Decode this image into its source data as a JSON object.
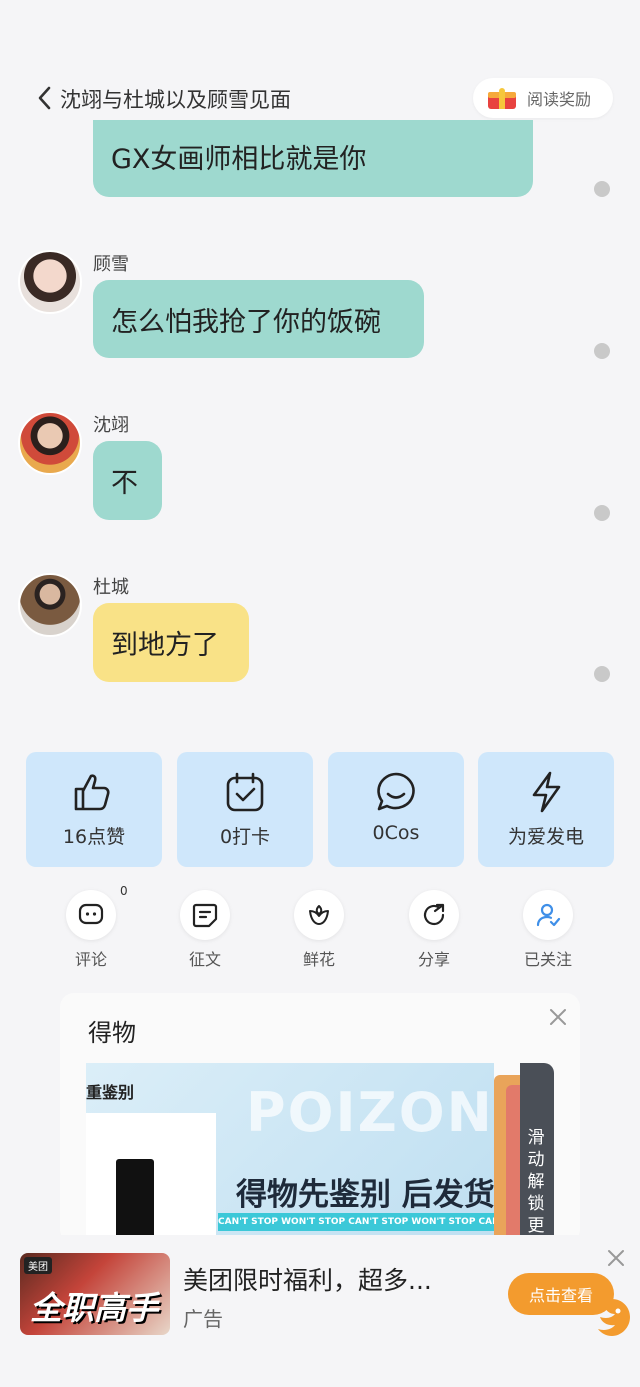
{
  "header": {
    "title": "沈翊与杜城以及顾雪见面",
    "reward_label": "阅读奖励"
  },
  "messages": [
    {
      "sender": "",
      "text": "GX女画师相比就是你",
      "color": "teal"
    },
    {
      "sender": "顾雪",
      "text": "怎么怕我抢了你的饭碗",
      "color": "teal"
    },
    {
      "sender": "沈翊",
      "text": "不",
      "color": "teal"
    },
    {
      "sender": "杜城",
      "text": "到地方了",
      "color": "yellow"
    }
  ],
  "stats": [
    {
      "label": "16点赞",
      "icon": "thumbs-up-icon"
    },
    {
      "label": "0打卡",
      "icon": "calendar-check-icon"
    },
    {
      "label": "0Cos",
      "icon": "chat-smile-icon"
    },
    {
      "label": "为爱发电",
      "icon": "lightning-icon"
    }
  ],
  "actions": [
    {
      "label": "评论",
      "icon": "comment-icon",
      "badge": "0"
    },
    {
      "label": "征文",
      "icon": "essay-icon"
    },
    {
      "label": "鲜花",
      "icon": "flower-icon"
    },
    {
      "label": "分享",
      "icon": "share-icon"
    },
    {
      "label": "已关注",
      "icon": "user-check-icon"
    }
  ],
  "ad_card": {
    "title": "得物",
    "banner_tag": "重鉴别",
    "banner_watermark": "POIZON",
    "banner_slogan": "得物先鉴别 后发货",
    "banner_strip": "CAN'T STOP WON'T STOP    CAN'T STOP WON'T STOP    CAN'T STOP WON'T STOP",
    "side_text": "滑动解锁更"
  },
  "bottom_ad": {
    "thumb_logo": "美团",
    "thumb_text": "全职高手",
    "title": "美团限时福利，超多...",
    "subtitle": "广告",
    "button": "点击查看"
  },
  "colors": {
    "bubble_teal": "#9ed9cf",
    "bubble_yellow": "#f9e287",
    "stat_card": "#cfe7fb",
    "ad_button": "#f39b2e"
  }
}
